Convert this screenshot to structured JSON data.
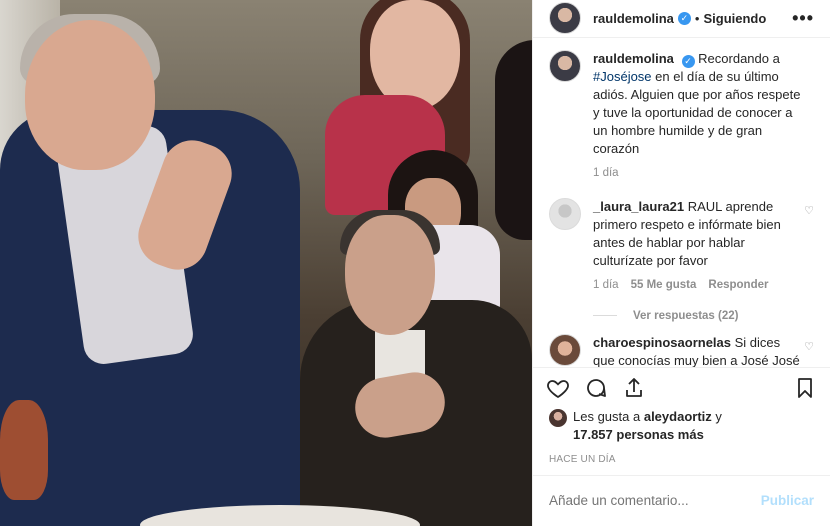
{
  "header": {
    "username": "rauldemolina",
    "verified_glyph": "✓",
    "separator": "•",
    "follow_status": "Siguiendo",
    "more_glyph": "•••"
  },
  "caption": {
    "username": "rauldemolina",
    "text_before": "Recordando a",
    "hashtag": "#Joséjose",
    "text_after": "en el día de su último adiós. Alguien que por años respete y tuve la oportunidad de conocer a un hombre humilde y de gran corazón",
    "time": "1 día"
  },
  "comments": [
    {
      "username": "_laura_laura21",
      "text": "RAUL aprende primero respeto e infórmate bien antes de hablar por hablar culturízate por favor",
      "time": "1 día",
      "likes": "55 Me gusta",
      "reply": "Responder",
      "view_replies": "Ver respuestas (22)"
    },
    {
      "username": "charoespinosaornelas",
      "text": "Si dices que conocías muy bien a José José y de la calidad de ser"
    }
  ],
  "likes": {
    "prefix": "Les gusta a",
    "user": "aleydaortiz",
    "middle": "y",
    "count": "17.857 personas más"
  },
  "time_ago": "HACE UN DÍA",
  "add_comment": {
    "placeholder": "Añade un comentario...",
    "post_label": "Publicar"
  },
  "icons": {
    "like": "heart-icon",
    "comment": "comment-icon",
    "share": "share-icon",
    "save": "bookmark-icon",
    "verified": "verified-badge-icon",
    "more": "more-options-icon"
  },
  "colors": {
    "verified": "#3897f0",
    "hashtag": "#003569",
    "muted": "#8e8e8e",
    "post_disabled": "#b2dffc"
  }
}
